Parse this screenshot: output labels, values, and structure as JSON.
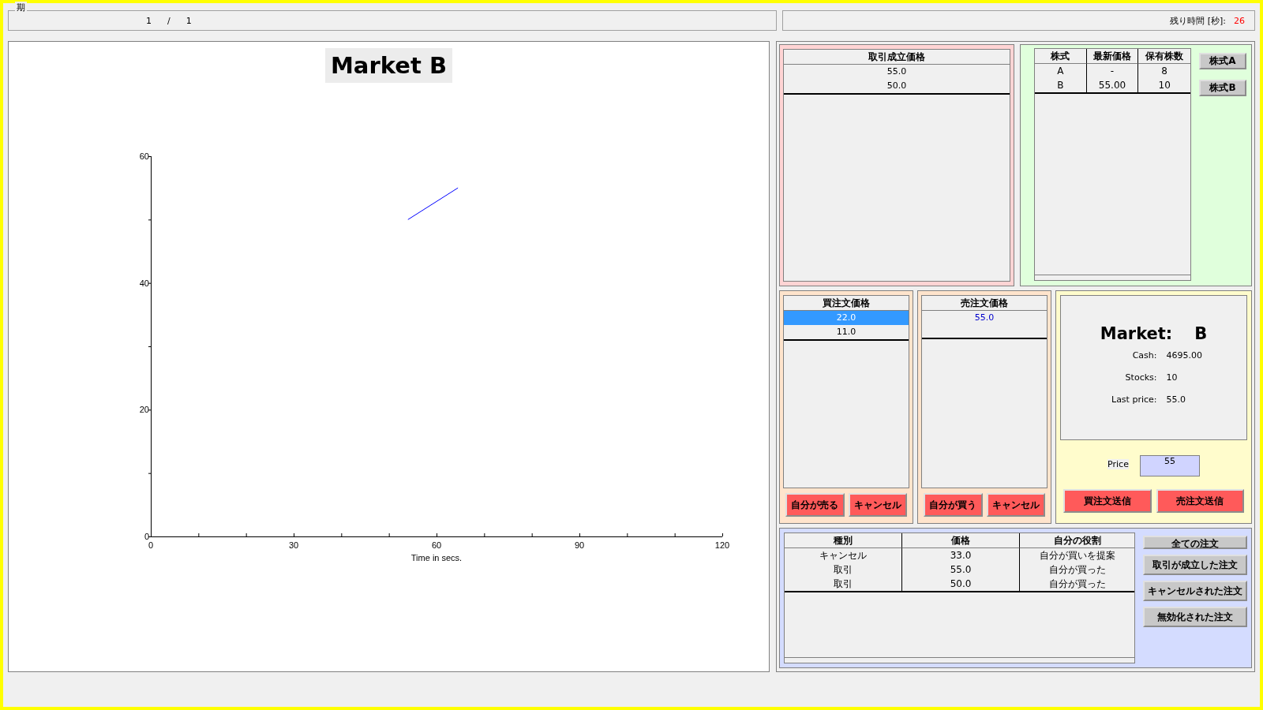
{
  "period": {
    "label": "期",
    "current": "1",
    "separator": "/",
    "total": "1"
  },
  "timer": {
    "label": "残り時間 [秒]:",
    "value": "26"
  },
  "chart_panel": {
    "title": "Market B",
    "chart_data": {
      "type": "line",
      "xlabel": "Time in secs.",
      "x": [
        54,
        64.5
      ],
      "series": [
        {
          "color": "#0000ff",
          "values": [
            50,
            55
          ]
        }
      ],
      "xlim": [
        0,
        120
      ],
      "ylim": [
        0,
        60
      ],
      "xticks": [
        0,
        30,
        60,
        90,
        120
      ],
      "yticks": [
        0,
        20,
        40,
        60
      ]
    }
  },
  "trades": {
    "header": "取引成立価格",
    "rows": [
      "55.0",
      "50.0"
    ]
  },
  "holdings": {
    "columns": [
      "株式",
      "最新価格",
      "保有株数"
    ],
    "rows": [
      [
        "A",
        "-",
        "8"
      ],
      [
        "B",
        "55.00",
        "10"
      ]
    ],
    "buttons": [
      "株式A",
      "株式B"
    ]
  },
  "buy_orders": {
    "header": "買注文価格",
    "rows": [
      {
        "price": "22.0",
        "selected": true,
        "mine": false
      },
      {
        "price": "11.0",
        "selected": false,
        "mine": false
      }
    ],
    "buttons": [
      "自分が売る",
      "キャンセル"
    ]
  },
  "sell_orders": {
    "header": "売注文価格",
    "rows": [
      {
        "price": "55.0",
        "selected": false,
        "mine": true
      }
    ],
    "buttons": [
      "自分が買う",
      "キャンセル"
    ]
  },
  "market": {
    "label": "Market:",
    "name": "B",
    "stats": [
      {
        "label": "Cash:",
        "value": "4695.00"
      },
      {
        "label": "Stocks:",
        "value": "10"
      },
      {
        "label": "Last price:",
        "value": "55.0"
      }
    ],
    "price_label": "Price",
    "price_value": "55",
    "buttons": [
      "買注文送信",
      "売注文送信"
    ]
  },
  "history": {
    "columns": [
      "種別",
      "価格",
      "自分の役割"
    ],
    "rows": [
      [
        "キャンセル",
        "33.0",
        "自分が買いを提案"
      ],
      [
        "取引",
        "55.0",
        "自分が買った"
      ],
      [
        "取引",
        "50.0",
        "自分が買った"
      ]
    ],
    "buttons": [
      "全ての注文",
      "取引が成立した注文",
      "キャンセルされた注文",
      "無効化された注文"
    ]
  }
}
